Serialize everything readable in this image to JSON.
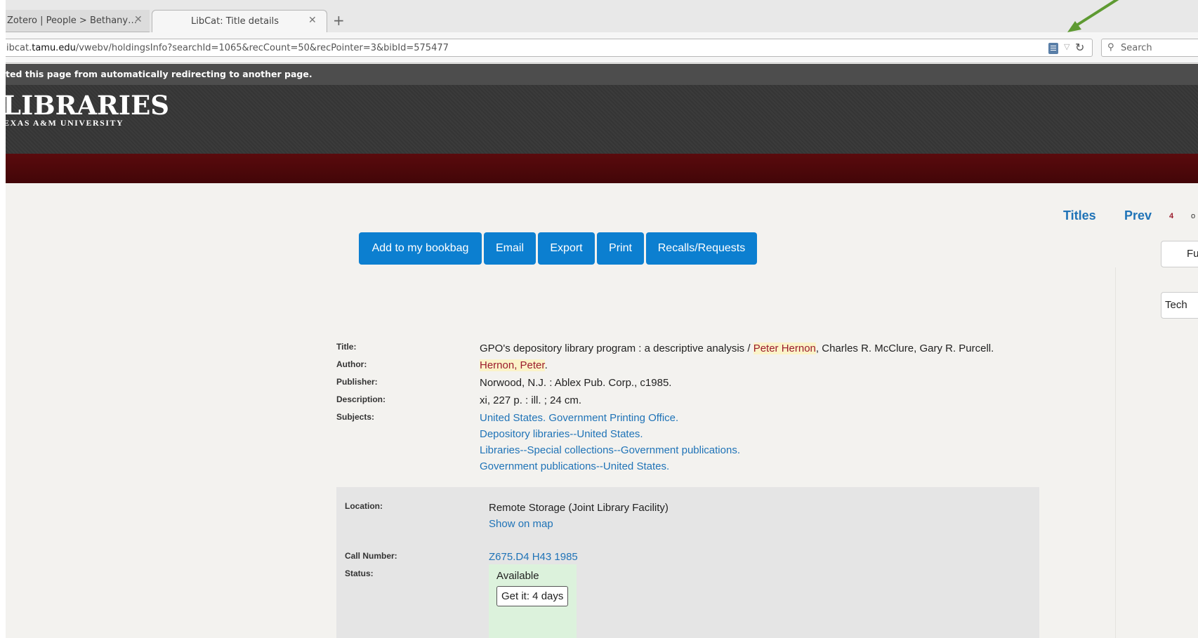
{
  "browser": {
    "tabs": [
      {
        "title": "Zotero | People > Bethany…",
        "close": "✕"
      },
      {
        "title": "LibCat: Title details",
        "close": "✕"
      }
    ],
    "new_tab": "+",
    "url": {
      "prefix": "ibcat.",
      "domain": "tamu.edu",
      "path": "/vwebv/holdingsInfo?searchId=1065&recCount=50&recPointer=3&bibId=575477"
    },
    "search_placeholder": "Search",
    "notice": "ted this page from automatically redirecting to another page."
  },
  "header": {
    "logo_main": "LIBRARIES",
    "logo_sub": "EXAS A&M UNIVERSITY"
  },
  "nav": {
    "titles": "Titles",
    "prev": "Prev",
    "record_number": "4",
    "record_of": "o",
    "side_btn_1": "Fu",
    "side_btn_2": "Tech"
  },
  "actions": {
    "bookbag": "Add to my bookbag",
    "email": "Email",
    "export": "Export",
    "print": "Print",
    "recalls": "Recalls/Requests"
  },
  "record": {
    "labels": {
      "title": "Title:",
      "author": "Author:",
      "publisher": "Publisher:",
      "description": "Description:",
      "subjects": "Subjects:"
    },
    "title_prefix": "GPO's depository library program : a descriptive analysis / ",
    "title_highlight": "Peter Hernon",
    "title_suffix": ", Charles R. McClure, Gary R. Purcell.",
    "author_highlight": "Hernon, Peter",
    "author_suffix": ".",
    "publisher": "Norwood, N.J. : Ablex Pub. Corp., c1985.",
    "description": "xi, 227 p. : ill. ; 24 cm.",
    "subjects": [
      "United States. Government Printing Office.",
      "Depository libraries--United States.",
      "Libraries--Special collections--Government publications.",
      "Government publications--United States."
    ]
  },
  "holdings": {
    "labels": {
      "location": "Location:",
      "call_number": "Call Number:",
      "status": "Status:"
    },
    "location": "Remote Storage (Joint Library Facility)",
    "show_on_map": "Show on map",
    "call_number": "Z675.D4 H43 1985",
    "status": "Available",
    "get_it": "Get it: 4 days"
  },
  "colors": {
    "accent_button": "#0c7fd0",
    "link": "#1f73b7",
    "maroon": "#500000",
    "header_dark": "#353535",
    "status_bg": "#dcf2dc",
    "annotation_arrow": "#5e9a32"
  }
}
